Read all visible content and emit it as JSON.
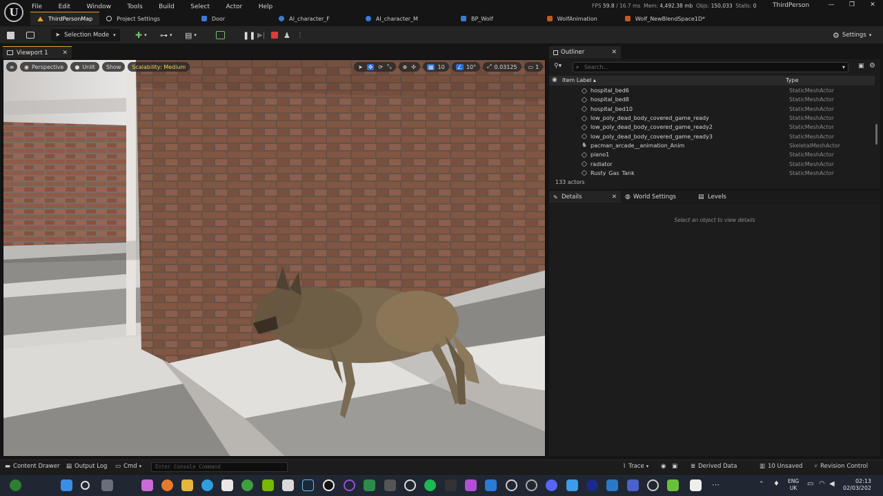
{
  "menubar": {
    "items": [
      "File",
      "Edit",
      "Window",
      "Tools",
      "Build",
      "Select",
      "Actor",
      "Help"
    ],
    "fps_label": "FPS",
    "fps": "59.8",
    "ms": "/ 16.7 ms",
    "mem_label": "Mem:",
    "mem": "4,492.38 mb",
    "objs_label": "Objs:",
    "objs": "150,033",
    "stalls_label": "Stalls:",
    "stalls": "0",
    "project": "ThirdPerson"
  },
  "tabs": [
    "ThirdPersonMap",
    "Project Settings",
    "Door",
    "AI_character_F",
    "AI_character_M",
    "BP_Wolf",
    "WolfAnimation",
    "Wolf_NewBlendSpace1D*"
  ],
  "toolbar": {
    "mode": "Selection Mode",
    "settings": "Settings"
  },
  "viewport": {
    "tab": "Viewport 1",
    "perspective": "Perspective",
    "unlit": "Unlit",
    "show": "Show",
    "scalability": "Scalability: Medium",
    "grid": "10",
    "angle": "10°",
    "scale": "0.03125",
    "cameras": "1"
  },
  "outliner": {
    "tab": "Outliner",
    "search_placeholder": "Search...",
    "col_label": "Item Label ▴",
    "col_type": "Type",
    "rows": [
      {
        "name": "hospital_bed6",
        "type": "StaticMeshActor"
      },
      {
        "name": "hospital_bed8",
        "type": "StaticMeshActor"
      },
      {
        "name": "hospital_bed10",
        "type": "StaticMeshActor"
      },
      {
        "name": "low_poly_dead_body_covered_game_ready",
        "type": "StaticMeshActor"
      },
      {
        "name": "low_poly_dead_body_covered_game_ready2",
        "type": "StaticMeshActor"
      },
      {
        "name": "low_poly_dead_body_covered_game_ready3",
        "type": "StaticMeshActor"
      },
      {
        "name": "pacman_arcade__animation_Anim",
        "type": "SkeletalMeshActor"
      },
      {
        "name": "piano1",
        "type": "StaticMeshActor"
      },
      {
        "name": "radiator",
        "type": "StaticMeshActor"
      },
      {
        "name": "Rusty_Gas_Tank",
        "type": "StaticMeshActor"
      }
    ],
    "count": "133 actors"
  },
  "details": {
    "tabs": [
      "Details",
      "World Settings",
      "Levels"
    ],
    "empty": "Select an object to view details"
  },
  "statusbar": {
    "content_drawer": "Content Drawer",
    "output_log": "Output Log",
    "cmd": "Cmd",
    "console_placeholder": "Enter Console Command",
    "trace": "Trace",
    "derived": "Derived Data",
    "unsaved": "10 Unsaved",
    "revision": "Revision Control"
  },
  "taskbar": {
    "lang1": "ENG",
    "lang2": "UK",
    "time": "02:13",
    "date": "02/03/202"
  }
}
